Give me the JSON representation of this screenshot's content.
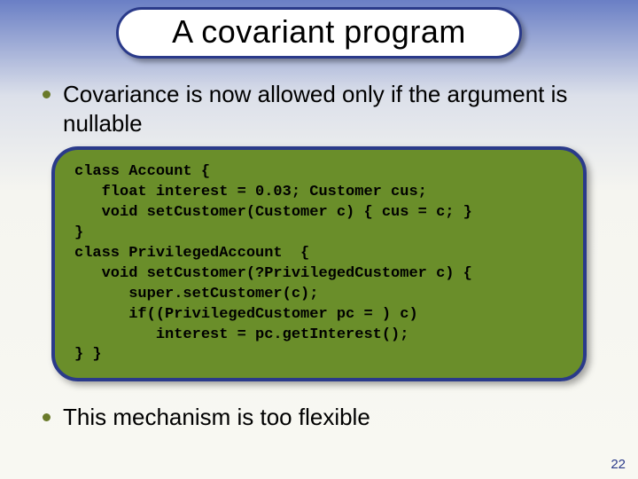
{
  "slide": {
    "title": "A covariant program",
    "bullet1": "Covariance is now allowed only if the argument is nullable",
    "bullet2": "This mechanism is too flexible",
    "page_number": "22"
  },
  "code": {
    "l1": "class Account {",
    "l2": "   float interest = 0.03; Customer cus;",
    "l3": "   void setCustomer(Customer c) { cus = c; }",
    "l4": "}",
    "l5": "class PrivilegedAccount  {",
    "l6": "   void setCustomer(?PrivilegedCustomer c) {",
    "l7": "      super.setCustomer(c);",
    "l8": "      if((PrivilegedCustomer pc = ) c)",
    "l9": "         interest = pc.getInterest();",
    "l10": "} }"
  }
}
